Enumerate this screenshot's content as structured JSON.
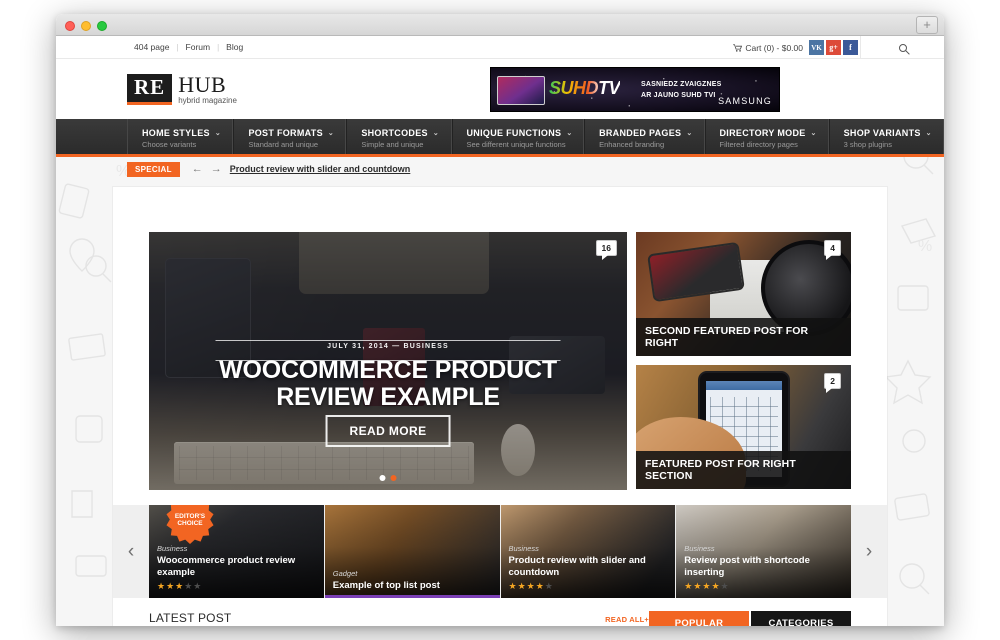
{
  "browser": {
    "newtab_label": "+"
  },
  "topbar": {
    "links": [
      "404 page",
      "Forum",
      "Blog"
    ],
    "separator": "|",
    "cart_label": "Cart (0) - $0.00",
    "cart_icon": "shopping-cart-icon",
    "social": [
      {
        "name": "vk",
        "glyph": "VK"
      },
      {
        "name": "google-plus",
        "glyph": "g+"
      },
      {
        "name": "facebook",
        "glyph": "f"
      }
    ],
    "search_icon": "search-icon"
  },
  "logo": {
    "mark": "RE",
    "name": "HUB",
    "tagline": "hybrid magazine"
  },
  "banner": {
    "brand_mark": "SUHD",
    "brand_suffix": "TV",
    "tagline_line1": "SASNIEDZ ZVAIGZNES",
    "tagline_line2": "AR JAUNO SUHD TVI",
    "advertiser": "SAMSUNG"
  },
  "nav": {
    "items": [
      {
        "title": "HOME STYLES",
        "sub": "Choose variants",
        "caret": "⌄"
      },
      {
        "title": "POST FORMATS",
        "sub": "Standard and unique",
        "caret": "⌄"
      },
      {
        "title": "SHORTCODES",
        "sub": "Simple and unique",
        "caret": "⌄"
      },
      {
        "title": "UNIQUE FUNCTIONS",
        "sub": "See different unique functions",
        "caret": "⌄"
      },
      {
        "title": "BRANDED PAGES",
        "sub": "Enhanced branding",
        "caret": "⌄"
      },
      {
        "title": "DIRECTORY MODE",
        "sub": "Filtered directory pages",
        "caret": "⌄"
      },
      {
        "title": "SHOP VARIANTS",
        "sub": "3 shop plugins",
        "caret": "⌄"
      }
    ]
  },
  "special": {
    "badge": "SPECIAL",
    "prev_arrow": "←",
    "next_arrow": "→",
    "link": "Product review with slider and countdown"
  },
  "hero": {
    "meta": "JULY 31, 2014  —  BUSINESS",
    "title": "WOOCOMMERCE PRODUCT REVIEW EXAMPLE",
    "button": "READ MORE",
    "comments": "16",
    "dots": [
      "inactive",
      "active"
    ]
  },
  "right_cards": [
    {
      "title": "SECOND FEATURED POST FOR RIGHT",
      "comments": "4"
    },
    {
      "title": "FEATURED POST FOR RIGHT SECTION",
      "comments": "2"
    }
  ],
  "carousel": {
    "prev": "‹",
    "next": "›",
    "editors_choice_line1": "EDITOR'S",
    "editors_choice_line2": "CHOICE",
    "items": [
      {
        "category": "Business",
        "title": "Woocommerce product review example",
        "rating": 3,
        "max_rating": 5
      },
      {
        "category": "Gadget",
        "title": "Example of top list post",
        "rating": 0,
        "max_rating": 5
      },
      {
        "category": "Business",
        "title": "Product review with slider and countdown",
        "rating": 4,
        "max_rating": 5
      },
      {
        "category": "Business",
        "title": "Review post with shortcode inserting",
        "rating": 4,
        "max_rating": 5
      }
    ]
  },
  "latest": {
    "title": "LATEST POST",
    "read_all": "READ ALL+",
    "tab_popular": "POPULAR",
    "tab_categories": "CATEGORIES"
  },
  "colors": {
    "accent": "#f26522",
    "nav_dark": "#2b2b2b",
    "black": "#161616"
  }
}
